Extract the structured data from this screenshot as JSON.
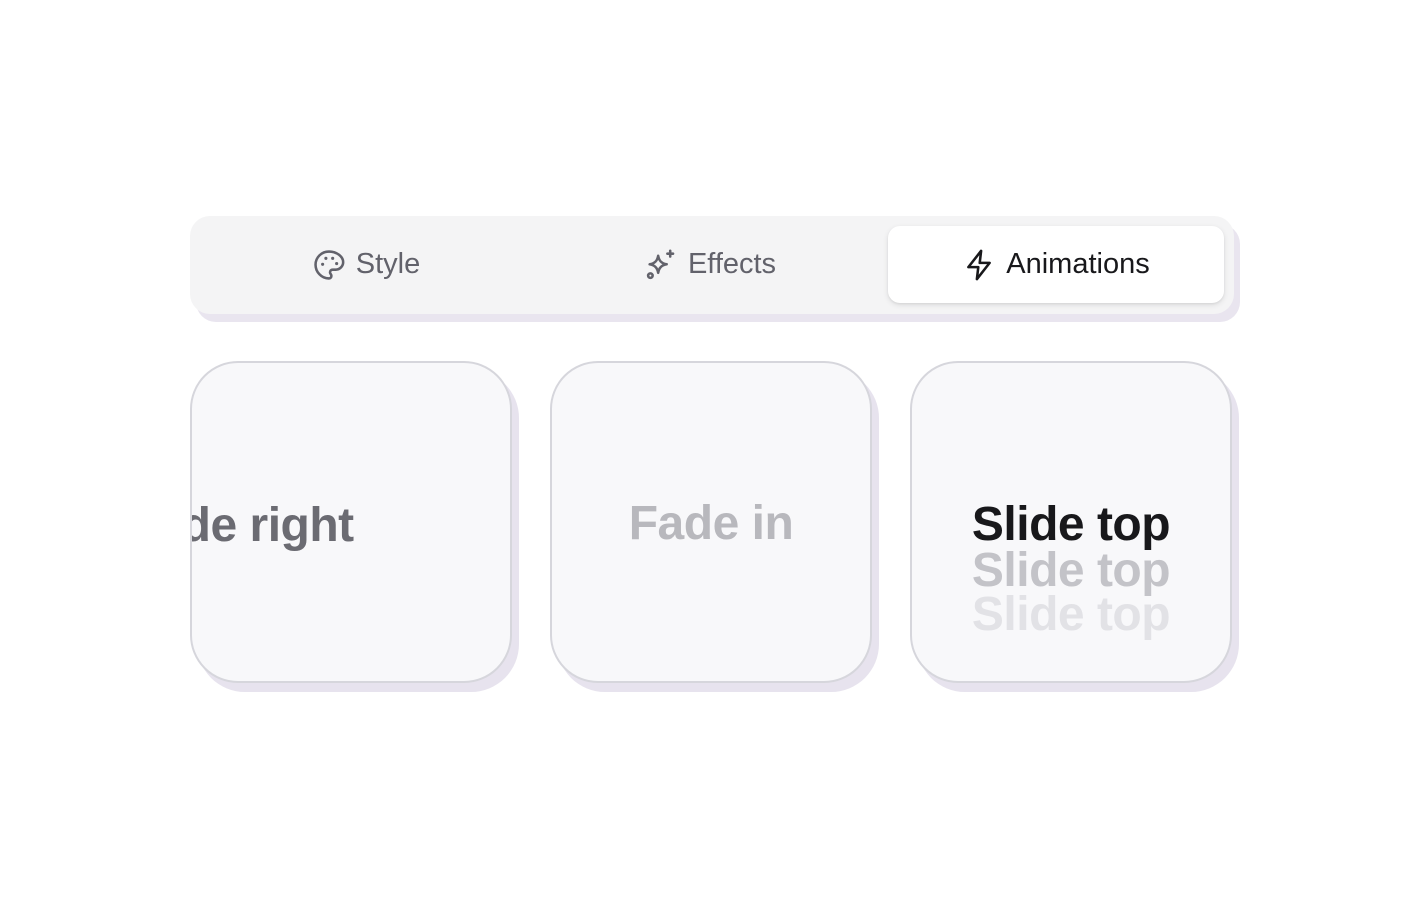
{
  "tabs": [
    {
      "label": "Style",
      "icon": "palette-icon",
      "selected": false
    },
    {
      "label": "Effects",
      "icon": "sparkles-icon",
      "selected": false
    },
    {
      "label": "Animations",
      "icon": "lightning-icon",
      "selected": true
    }
  ],
  "cards": [
    {
      "label": "lide right",
      "animation": "slide-right"
    },
    {
      "label": "Fade in",
      "animation": "fade-in"
    },
    {
      "label": "Slide top",
      "label_trail_1": "Slide top",
      "label_trail_2": "Slide top",
      "animation": "slide-top"
    }
  ],
  "colors": {
    "tab_bar_bg": "#f4f4f5",
    "tab_active_bg": "#ffffff",
    "tab_active_text": "#18181b",
    "tab_inactive_text": "#62626b",
    "card_bg": "#f8f8fa",
    "card_border": "#d6d6dc",
    "shadow_tint": "#e9e5ef"
  }
}
